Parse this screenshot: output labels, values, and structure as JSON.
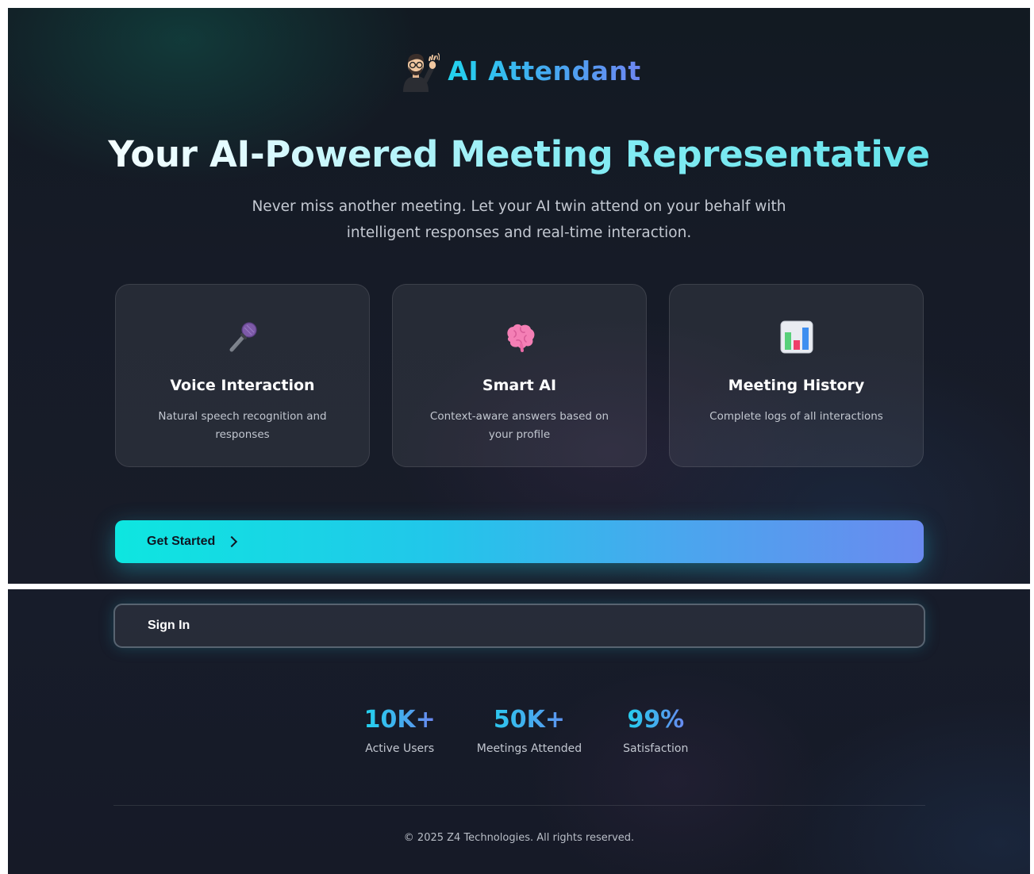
{
  "brand": {
    "title": "AI Attendant",
    "icon": "waving-person-avatar-icon"
  },
  "hero": {
    "title": "Your AI-Powered Meeting Representative",
    "subtitle": "Never miss another meeting. Let your AI twin attend on your behalf with intelligent responses and real-time interaction."
  },
  "features": [
    {
      "icon": "microphone-icon",
      "title": "Voice Interaction",
      "description": "Natural speech recognition and responses"
    },
    {
      "icon": "brain-icon",
      "title": "Smart AI",
      "description": "Context-aware answers based on your profile"
    },
    {
      "icon": "bar-chart-icon",
      "title": "Meeting History",
      "description": "Complete logs of all interactions"
    }
  ],
  "actions": {
    "get_started": "Get Started",
    "sign_in": "Sign In"
  },
  "stats": [
    {
      "value": "10K+",
      "label": "Active Users"
    },
    {
      "value": "50K+",
      "label": "Meetings Attended"
    },
    {
      "value": "99%",
      "label": "Satisfaction"
    }
  ],
  "footer": {
    "copyright": "© 2025 Z4 Technologies. All rights reserved."
  },
  "colors": {
    "accent_cyan": "#22d3ee",
    "accent_indigo": "#6e86f2",
    "background": "#161b27"
  }
}
